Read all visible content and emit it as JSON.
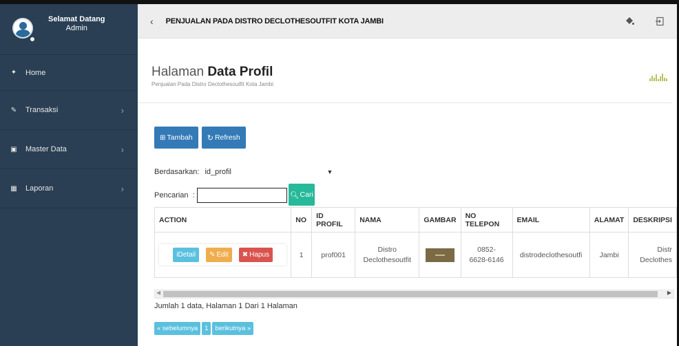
{
  "sidebar": {
    "welcome": "Selamat Datang",
    "user": "Admin",
    "items": [
      {
        "label": "Home",
        "icon": "home-icon",
        "glyph": "✦",
        "chevron": ""
      },
      {
        "label": "Transaksi",
        "icon": "pencil-icon",
        "glyph": "✎",
        "chevron": "›"
      },
      {
        "label": "Master Data",
        "icon": "edit-icon",
        "glyph": "▣",
        "chevron": "›"
      },
      {
        "label": "Laporan",
        "icon": "calendar-icon",
        "glyph": "▦",
        "chevron": "›"
      }
    ]
  },
  "topbar": {
    "title": "PENJUALAN PADA DISTRO DECLOTHESOUTFIT KOTA JAMBI",
    "back": "‹"
  },
  "page": {
    "title_light": "Halaman ",
    "title_bold": "Data Profil",
    "subtitle": "Penjualan Pada Distro Declothesoutfit Kota Jambi"
  },
  "buttons": {
    "add": "Tambah",
    "refresh": "Refresh"
  },
  "filter": {
    "label": "Berdasarkan:",
    "selected": "id_profil",
    "search_label": "Pencarian",
    "search_value": "",
    "search_button": "Cari"
  },
  "table": {
    "headers": [
      "ACTION",
      "NO",
      "ID PROFIL",
      "NAMA",
      "GAMBAR",
      "NO TELEPON",
      "EMAIL",
      "ALAMAT",
      "DESKRIPSI"
    ],
    "rows": [
      {
        "actions": {
          "detail": "Detail",
          "edit": "Edit",
          "delete": "Hapus"
        },
        "no": "1",
        "id_profil": "prof001",
        "nama_1": "Distro",
        "nama_2": "Declothesoutfit",
        "telepon_1": "0852-",
        "telepon_2": "6628-6146",
        "email": "distrodeclothesoutfi",
        "alamat": "Jambi",
        "deskripsi_1": "Distr",
        "deskripsi_2": "Declothes"
      }
    ]
  },
  "info": "Jumlah 1 data, Halaman 1 Dari 1 Halaman",
  "pager": {
    "prev": "« sebelumnya",
    "page": "1",
    "next": "berikutnya »"
  },
  "colors": {
    "sidebar": "#2a3f54",
    "primary": "#337ab7",
    "success": "#26b99a",
    "info": "#5bc0de",
    "warning": "#f0ad4e",
    "danger": "#d9534f"
  }
}
